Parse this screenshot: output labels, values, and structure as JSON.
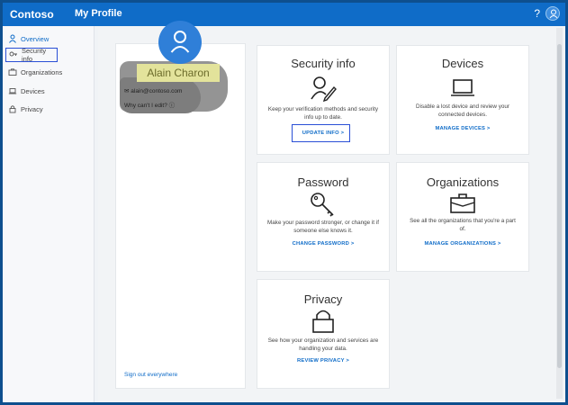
{
  "topbar": {
    "brand": "Contoso",
    "app_name": "My Profile",
    "help_glyph": "?"
  },
  "sidebar": {
    "items": [
      {
        "label": "Overview",
        "icon": "person-icon"
      },
      {
        "label": "Security info",
        "icon": "key-icon"
      },
      {
        "label": "Organizations",
        "icon": "briefcase-icon"
      },
      {
        "label": "Devices",
        "icon": "laptop-icon"
      },
      {
        "label": "Privacy",
        "icon": "lock-icon"
      }
    ]
  },
  "profile": {
    "name": "Alain Charon",
    "email": "alain@contoso.com",
    "why_cant_edit": "Why can't I edit?",
    "sign_out": "Sign out everywhere"
  },
  "cards": {
    "security": {
      "title": "Security info",
      "desc": "Keep your verification methods and security info up to date.",
      "link": "UPDATE INFO >"
    },
    "devices": {
      "title": "Devices",
      "desc": "Disable a lost device and review your connected devices.",
      "link": "MANAGE DEVICES >"
    },
    "password": {
      "title": "Password",
      "desc": "Make your password stronger, or change it if someone else knows it.",
      "link": "CHANGE PASSWORD >"
    },
    "organizations": {
      "title": "Organizations",
      "desc": "See all the organizations that you're a part of.",
      "link": "MANAGE ORGANIZATIONS >"
    },
    "privacy": {
      "title": "Privacy",
      "desc": "See how your organization and services are handling your data.",
      "link": "REVIEW PRIVACY >"
    }
  },
  "colors": {
    "accent": "#0f6cc8",
    "highlight_box": "#2a4fd6",
    "name_highlight": "#e3e39b"
  }
}
